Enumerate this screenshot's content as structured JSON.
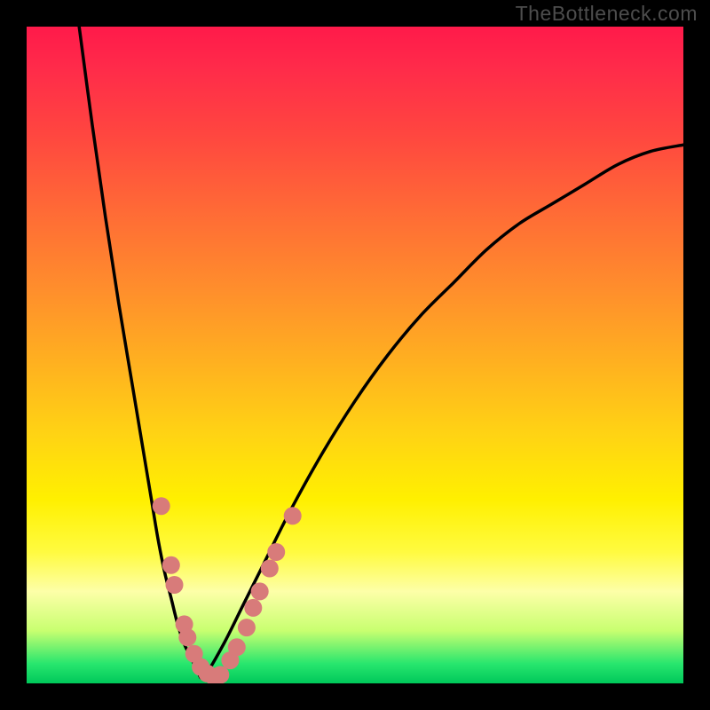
{
  "watermark": "TheBottleneck.com",
  "colors": {
    "page_bg": "#000000",
    "watermark": "#4d4d4d",
    "curve": "#000000",
    "marker_fill": "#d87b7a",
    "marker_stroke": "#d87b7a"
  },
  "chart_data": {
    "type": "line",
    "title": "",
    "xlabel": "",
    "ylabel": "",
    "xlim": [
      0,
      100
    ],
    "ylim": [
      0,
      100
    ],
    "legend": false,
    "grid": false,
    "series": [
      {
        "name": "curve-left",
        "x": [
          8,
          10,
          12,
          14,
          16,
          18,
          19,
          20,
          21,
          22,
          23,
          24,
          25,
          26,
          27
        ],
        "y": [
          100,
          85,
          71,
          58,
          46,
          34,
          28,
          22,
          17,
          13,
          9,
          6,
          4,
          2,
          1
        ]
      },
      {
        "name": "curve-right",
        "x": [
          27,
          30,
          33,
          36,
          40,
          45,
          50,
          55,
          60,
          65,
          70,
          75,
          80,
          85,
          90,
          95,
          100
        ],
        "y": [
          1,
          6,
          12,
          18,
          26,
          35,
          43,
          50,
          56,
          61,
          66,
          70,
          73,
          76,
          79,
          81,
          82
        ]
      }
    ],
    "scatter_markers": {
      "name": "highlight-points",
      "points": [
        {
          "x": 20.5,
          "y": 27
        },
        {
          "x": 22.0,
          "y": 18
        },
        {
          "x": 22.5,
          "y": 15
        },
        {
          "x": 24.0,
          "y": 9
        },
        {
          "x": 24.5,
          "y": 7
        },
        {
          "x": 25.5,
          "y": 4.5
        },
        {
          "x": 26.5,
          "y": 2.5
        },
        {
          "x": 27.5,
          "y": 1.5
        },
        {
          "x": 28.5,
          "y": 1.0
        },
        {
          "x": 29.5,
          "y": 1.3
        },
        {
          "x": 31.0,
          "y": 3.5
        },
        {
          "x": 32.0,
          "y": 5.5
        },
        {
          "x": 33.5,
          "y": 8.5
        },
        {
          "x": 34.5,
          "y": 11.5
        },
        {
          "x": 35.5,
          "y": 14.0
        },
        {
          "x": 37.0,
          "y": 17.5
        },
        {
          "x": 38.0,
          "y": 20.0
        },
        {
          "x": 40.5,
          "y": 25.5
        }
      ]
    },
    "gradient_stops": [
      {
        "pct": 0,
        "color": "#ff1a4a"
      },
      {
        "pct": 16,
        "color": "#ff4540"
      },
      {
        "pct": 40,
        "color": "#ff8e2c"
      },
      {
        "pct": 62,
        "color": "#ffd314"
      },
      {
        "pct": 80,
        "color": "#fffb40"
      },
      {
        "pct": 92,
        "color": "#c8ff70"
      },
      {
        "pct": 100,
        "color": "#00c85a"
      }
    ]
  }
}
